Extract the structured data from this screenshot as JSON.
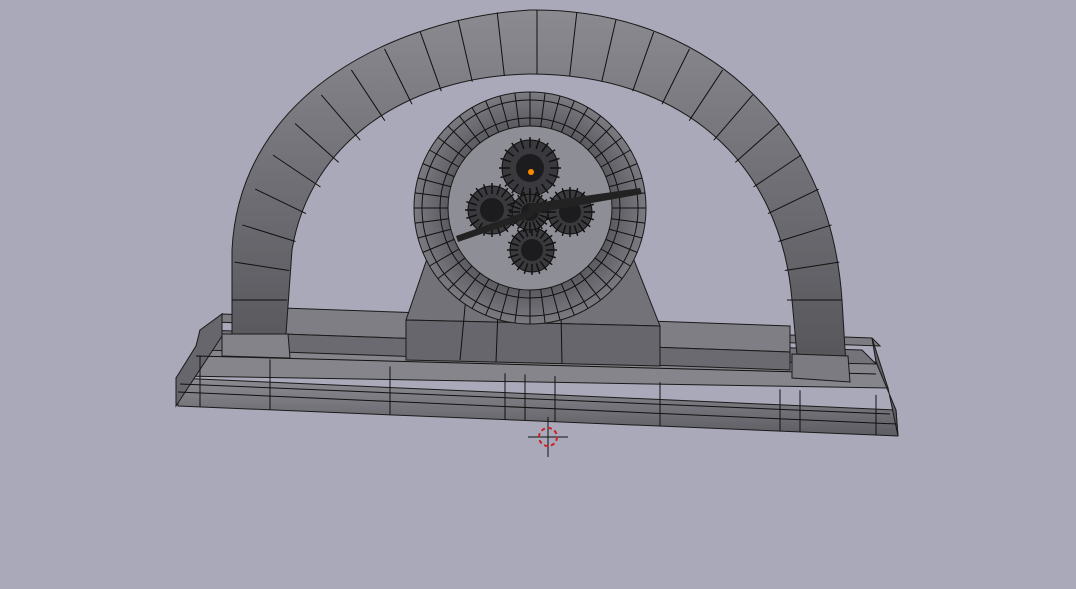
{
  "viewport": {
    "background_color": "#a9a9b9",
    "mesh_color": "#6b6b70",
    "wire_color": "#111111",
    "selected_vertex_color": "#ff8a00",
    "cursor_color": "#cc2222"
  },
  "scene": {
    "object": "mantel-clock-mesh",
    "mode": "edit-mode-wireframe",
    "cursor": "3d-cursor-icon"
  }
}
